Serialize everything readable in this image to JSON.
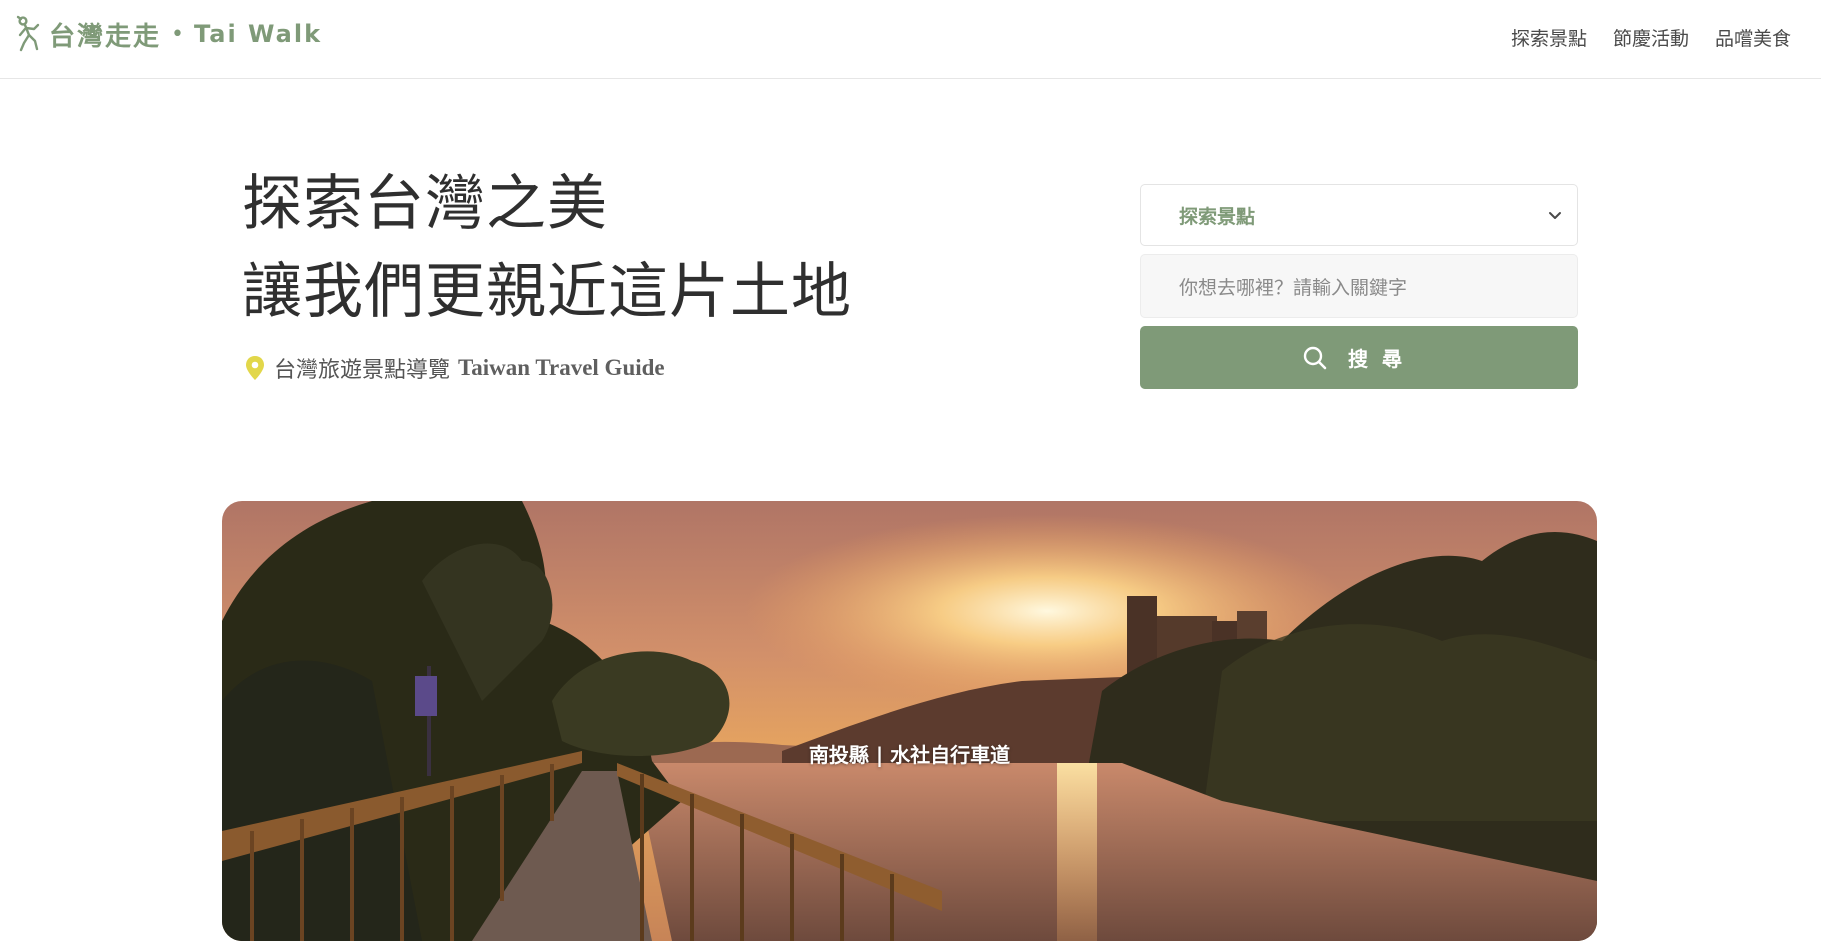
{
  "brand": {
    "name_zh": "台灣走走",
    "separator": "•",
    "name_en": "Tai Walk",
    "color": "#7f9a78"
  },
  "nav": {
    "items": [
      {
        "label": "探索景點"
      },
      {
        "label": "節慶活動"
      },
      {
        "label": "品嚐美食"
      }
    ]
  },
  "hero": {
    "title_prefix": "探索",
    "title_highlight": "台灣之美",
    "title_line2": "讓我們更親近這片土地",
    "subtitle_zh": "台灣旅遊景點導覽",
    "subtitle_en": "Taiwan Travel Guide",
    "highlight_color": "#e2d74a",
    "pin_icon": "map-pin-icon"
  },
  "search": {
    "category_selected": "探索景點",
    "keyword_placeholder": "你想去哪裡？請輸入關鍵字",
    "button_label": "搜尋",
    "button_color": "#7f9a78",
    "button_icon": "search-icon",
    "select_icon": "chevron-down-icon"
  },
  "banner": {
    "caption": "南投縣 | 水社自行車道"
  }
}
